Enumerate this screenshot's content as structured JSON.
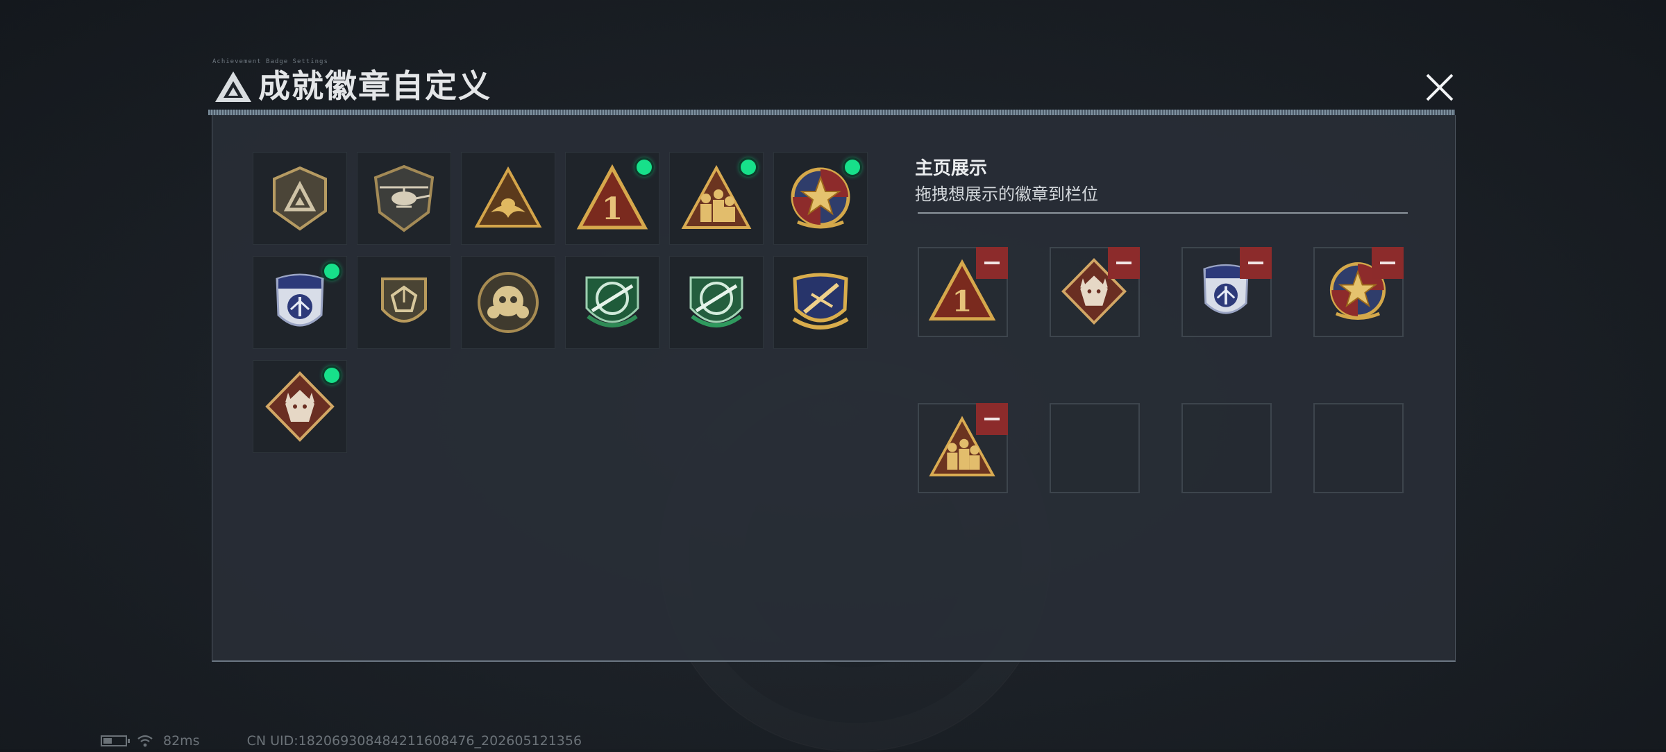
{
  "dialog": {
    "title": "成就徽章自定义",
    "header_deco": "Achievement Badge Settings",
    "close_icon": "close-icon"
  },
  "badge_grid": {
    "badges": [
      {
        "name": "logo-shield-badge",
        "new": false
      },
      {
        "name": "helicopter-shield-badge",
        "new": false
      },
      {
        "name": "eagle-triangle-badge",
        "new": false
      },
      {
        "name": "number-one-triangle-badge",
        "new": true
      },
      {
        "name": "soldiers-triangle-badge",
        "new": true
      },
      {
        "name": "star-compass-badge",
        "new": true
      },
      {
        "name": "blue-police-shield-badge",
        "new": true
      },
      {
        "name": "dice-shield-badge",
        "new": false
      },
      {
        "name": "skull-round-badge",
        "new": false
      },
      {
        "name": "green-rifle-crosshair-badge",
        "new": false
      },
      {
        "name": "green-rifle-crosshair-badge-2",
        "new": false
      },
      {
        "name": "gold-jet-shield-badge",
        "new": false
      },
      {
        "name": "wolf-diamond-badge",
        "new": true
      }
    ]
  },
  "showcase": {
    "title": "主页展示",
    "subtitle": "拖拽想展示的徽章到栏位",
    "slots": [
      {
        "badge": "number-one-triangle-badge",
        "filled": true
      },
      {
        "badge": "wolf-diamond-badge",
        "filled": true
      },
      {
        "badge": "blue-police-shield-badge",
        "filled": true
      },
      {
        "badge": "star-compass-badge",
        "filled": true
      },
      {
        "badge": "soldiers-triangle-badge",
        "filled": true
      },
      {
        "badge": "",
        "filled": false
      },
      {
        "badge": "",
        "filled": false
      },
      {
        "badge": "",
        "filled": false
      }
    ]
  },
  "status_bar": {
    "ping": "82ms",
    "uid": "CN UID:18206930848421160847​6_202605121356"
  },
  "colors": {
    "new_dot": "#17e08a",
    "remove": "#8c2b2b",
    "panel": "#282e36"
  }
}
